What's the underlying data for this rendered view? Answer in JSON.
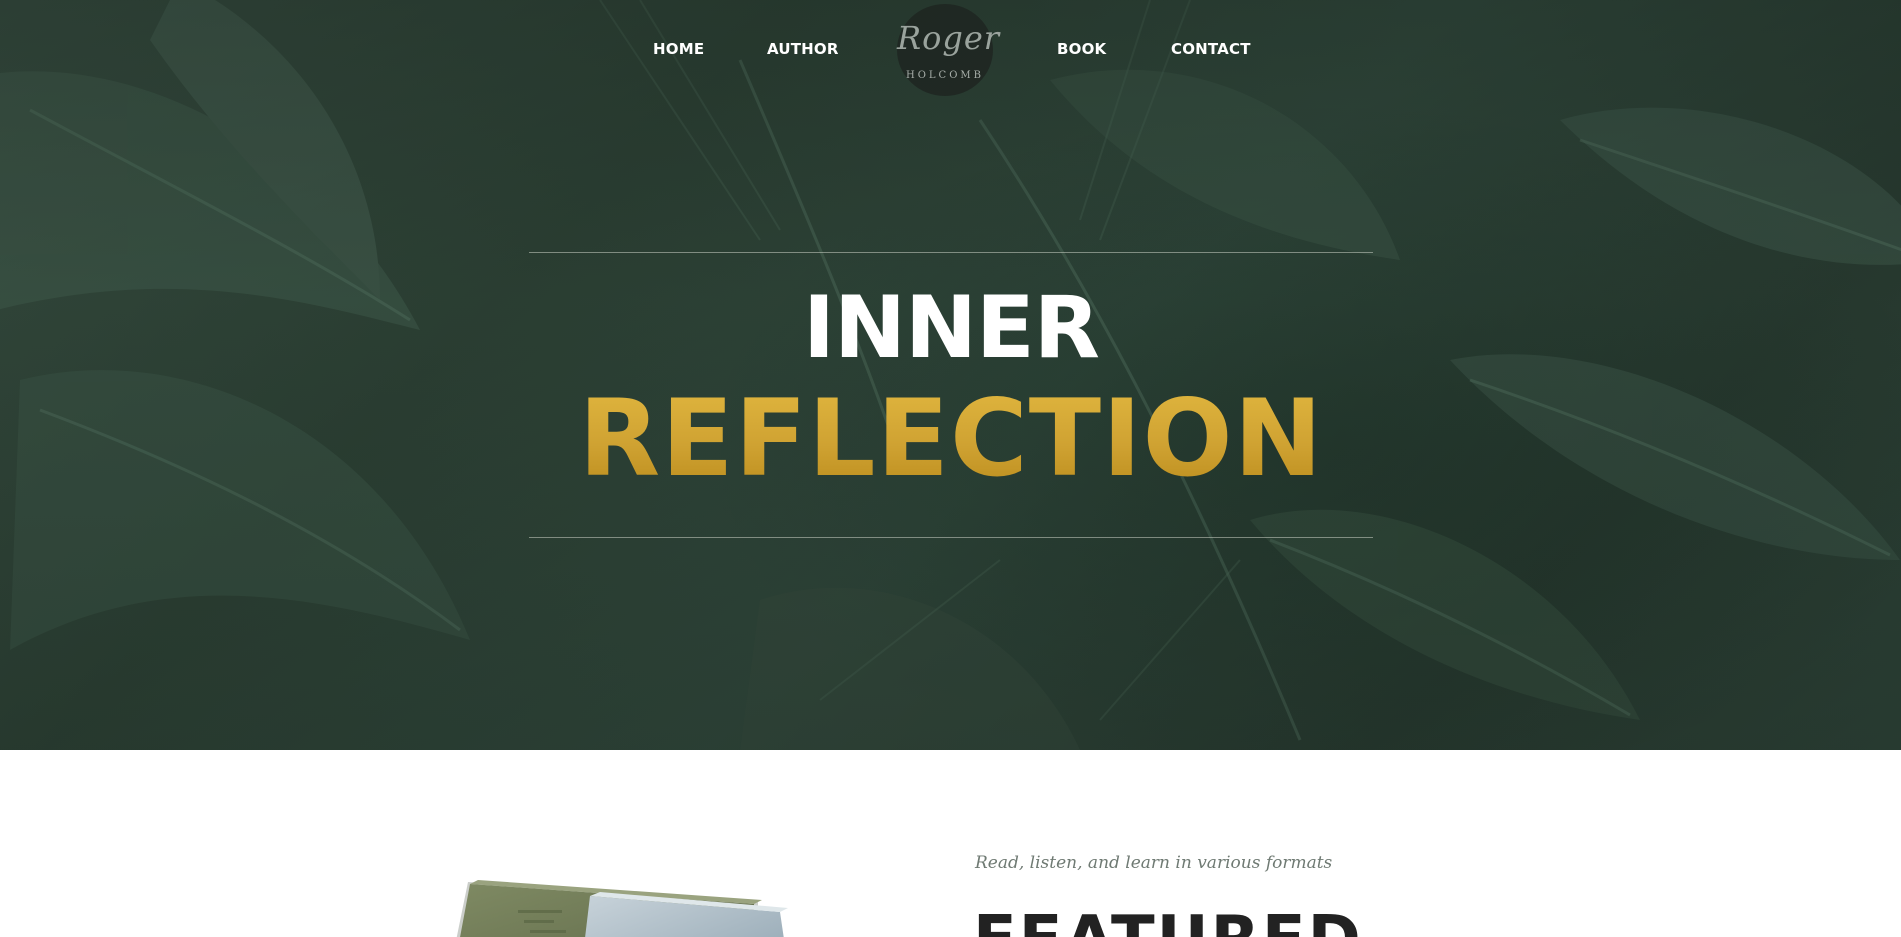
{
  "nav": {
    "home": "HOME",
    "author": "AUTHOR",
    "book": "BOOK",
    "contact": "CONTACT"
  },
  "logo": {
    "script": "Roger",
    "sub": "HOLCOMB"
  },
  "hero": {
    "title_line1": "INNER",
    "title_line2": "REFLECTION"
  },
  "featured_section": {
    "tagline": "Read, listen, and learn in various formats",
    "heading": "FEATURED"
  },
  "colors": {
    "hero_green": "#2f443a",
    "accent_gold": "#cfa232",
    "heading_dark": "#222222",
    "tagline_gray": "#6f7a73"
  }
}
